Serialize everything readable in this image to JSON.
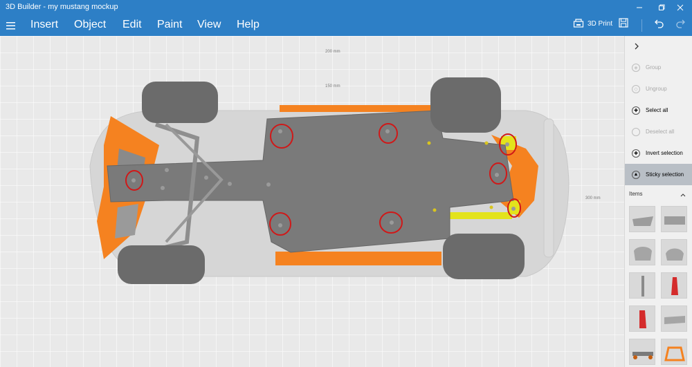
{
  "window": {
    "title": "3D Builder - my mustang mockup"
  },
  "menu": {
    "items": [
      "Insert",
      "Object",
      "Edit",
      "Paint",
      "View",
      "Help"
    ]
  },
  "toolbar": {
    "print_label": "3D Print"
  },
  "viewport": {
    "measure_top": "200 mm",
    "measure_mid": "150 mm",
    "measure_right": "300 mm"
  },
  "panel": {
    "actions": [
      {
        "label": "Group",
        "icon": "group-icon",
        "enabled": false
      },
      {
        "label": "Ungroup",
        "icon": "ungroup-icon",
        "enabled": false
      },
      {
        "label": "Select all",
        "icon": "select-all-icon",
        "enabled": true
      },
      {
        "label": "Deselect all",
        "icon": "deselect-all-icon",
        "enabled": false
      },
      {
        "label": "Invert selection",
        "icon": "invert-selection-icon",
        "enabled": true
      },
      {
        "label": "Sticky selection",
        "icon": "sticky-selection-icon",
        "enabled": true,
        "active": true
      }
    ],
    "items_label": "Items"
  },
  "colors": {
    "titlebar": "#2d7fc6",
    "chassis": "#7a7a7a",
    "orange": "#f58220",
    "highlight": "#e3e31c",
    "circle": "#d01818",
    "tire": "#6b6b6b"
  }
}
